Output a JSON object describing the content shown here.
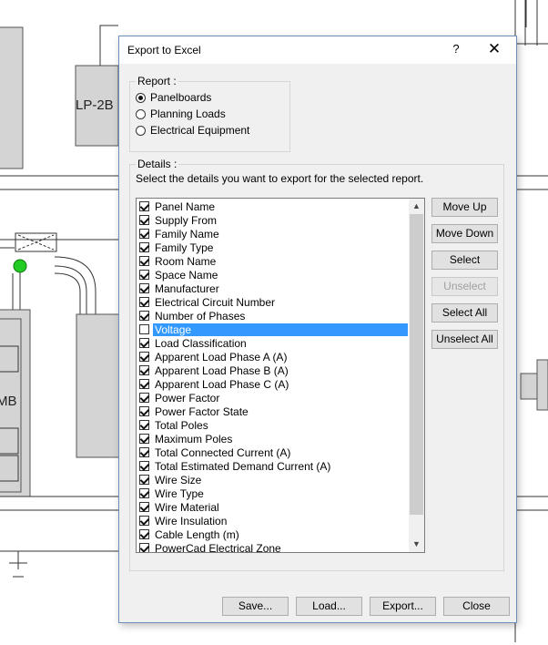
{
  "background": {
    "labels": [
      "LP-2B",
      "MB"
    ]
  },
  "dialog": {
    "title": "Export to Excel",
    "help_label": "?",
    "close_label": "✕",
    "report": {
      "legend": "Report :",
      "options": [
        {
          "label": "Panelboards",
          "selected": true
        },
        {
          "label": "Planning Loads",
          "selected": false
        },
        {
          "label": "Electrical Equipment",
          "selected": false
        }
      ]
    },
    "details": {
      "legend": "Details :",
      "instruction": "Select the details you want to export for the selected report.",
      "items": [
        {
          "label": "Panel Name",
          "checked": true
        },
        {
          "label": "Supply From",
          "checked": true
        },
        {
          "label": "Family Name",
          "checked": true
        },
        {
          "label": "Family Type",
          "checked": true
        },
        {
          "label": "Room Name",
          "checked": true
        },
        {
          "label": "Space Name",
          "checked": true
        },
        {
          "label": "Manufacturer",
          "checked": true
        },
        {
          "label": "Electrical Circuit Number",
          "checked": true
        },
        {
          "label": "Number of Phases",
          "checked": true
        },
        {
          "label": "Voltage",
          "checked": false,
          "selected": true
        },
        {
          "label": "Load Classification",
          "checked": true
        },
        {
          "label": "Apparent Load Phase A (A)",
          "checked": true
        },
        {
          "label": "Apparent Load Phase B (A)",
          "checked": true
        },
        {
          "label": "Apparent Load Phase C (A)",
          "checked": true
        },
        {
          "label": "Power Factor",
          "checked": true
        },
        {
          "label": "Power Factor State",
          "checked": true
        },
        {
          "label": "Total Poles",
          "checked": true
        },
        {
          "label": "Maximum Poles",
          "checked": true
        },
        {
          "label": "Total Connected Current (A)",
          "checked": true
        },
        {
          "label": "Total Estimated Demand Current (A)",
          "checked": true
        },
        {
          "label": "Wire Size",
          "checked": true
        },
        {
          "label": "Wire Type",
          "checked": true
        },
        {
          "label": "Wire Material",
          "checked": true
        },
        {
          "label": "Wire Insulation",
          "checked": true
        },
        {
          "label": "Cable Length (m)",
          "checked": true
        },
        {
          "label": "PowerCad Electrical Zone",
          "checked": true
        }
      ],
      "buttons": {
        "move_up": "Move Up",
        "move_down": "Move Down",
        "select": "Select",
        "unselect": "Unselect",
        "select_all": "Select All",
        "unselect_all": "Unselect All"
      }
    },
    "footer": {
      "save": "Save...",
      "load": "Load...",
      "export": "Export...",
      "close": "Close"
    }
  }
}
